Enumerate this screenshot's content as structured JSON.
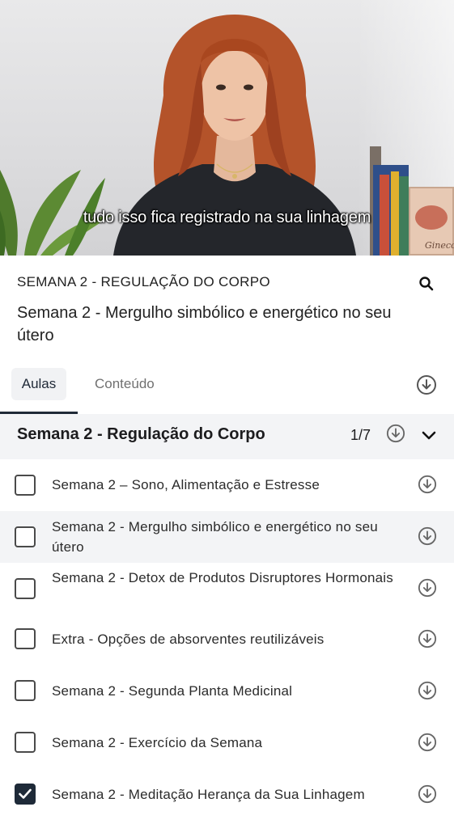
{
  "video": {
    "subtitle": "tudo isso fica registrado na sua linhagem",
    "book_spine_text": "Gineco"
  },
  "header": {
    "module_title": "SEMANA 2 - REGULAÇÃO DO CORPO",
    "lesson_title": "Semana 2 - Mergulho simbólico e energético no seu útero",
    "search_icon": "search-icon"
  },
  "tabs": {
    "aulas": "Aulas",
    "conteudo": "Conteúdo",
    "active": "Aulas"
  },
  "section": {
    "title": "Semana 2 - Regulação do Corpo",
    "count": "1/7"
  },
  "lessons": [
    {
      "label": "Semana 2  – Sono, Alimentação e Estresse",
      "checked": false,
      "active": false
    },
    {
      "label": "Semana 2 - Mergulho simbólico e energético no seu útero",
      "checked": false,
      "active": true
    },
    {
      "label": "Semana 2 - Detox de Produtos Disruptores Hormonais",
      "checked": false,
      "active": false
    },
    {
      "label": "Extra - Opções de absorventes reutilizáveis",
      "checked": false,
      "active": false
    },
    {
      "label": "Semana 2 - Segunda Planta Medicinal",
      "checked": false,
      "active": false
    },
    {
      "label": "Semana 2 - Exercício da Semana",
      "checked": false,
      "active": false
    },
    {
      "label": "Semana 2 - Meditação Herança da Sua Linhagem",
      "checked": true,
      "active": false
    }
  ],
  "colors": {
    "accent_dark": "#1e2a38",
    "row_highlight": "#f3f4f6"
  }
}
